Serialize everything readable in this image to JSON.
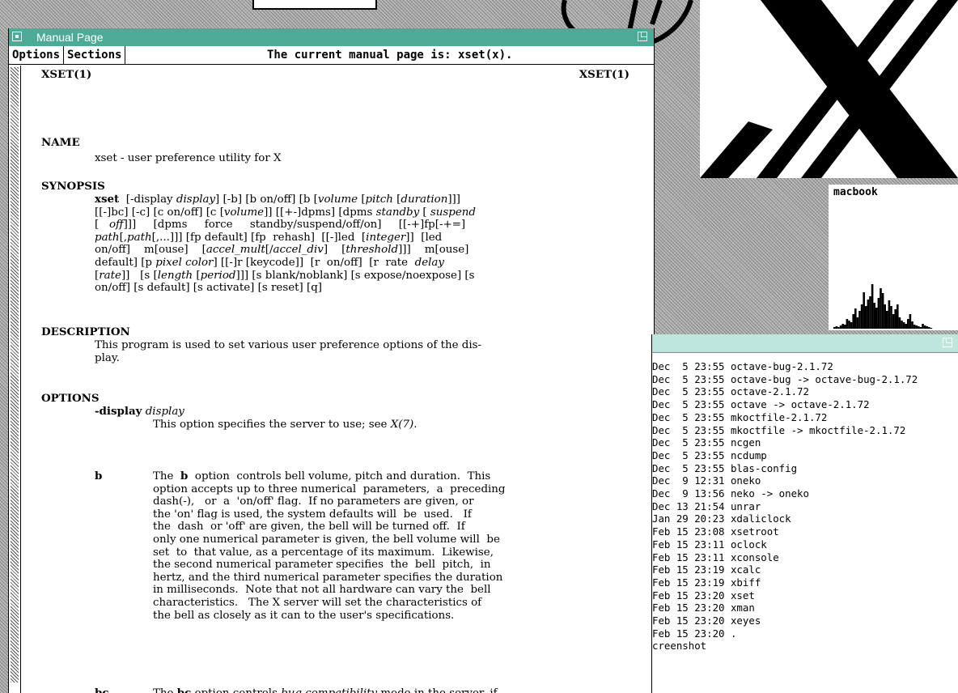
{
  "desktop": {
    "xload_host": "macbook",
    "xload_samples": [
      2,
      3,
      2,
      4,
      6,
      5,
      12,
      10,
      8,
      18,
      25,
      14,
      22,
      30,
      45,
      28,
      36,
      40,
      55,
      32,
      26,
      38,
      50,
      44,
      30,
      22,
      35,
      28,
      18,
      24,
      30,
      14,
      10,
      8,
      6,
      12,
      18,
      9,
      5,
      4,
      3,
      2,
      6,
      4,
      3,
      2,
      1
    ]
  },
  "man": {
    "title": "Manual Page",
    "menu_options": "Options",
    "menu_sections": "Sections",
    "status": "The current manual page is: xset(x).",
    "header_left": "XSET(1)",
    "header_right": "XSET(1)",
    "name_head": "NAME",
    "name_text": "xset - user preference utility for X",
    "synopsis_head": "SYNOPSIS",
    "description_head": "DESCRIPTION",
    "description_text": "This program is used to set various user preference options of the dis-\nplay.",
    "options_head": "OPTIONS",
    "opt_display_text": "This option specifies the server to use; see ",
    "opt_display_ref": "X(7)",
    "opt_b_name": "b",
    "opt_bc_name": "bc"
  },
  "console": {
    "lines": [
      "Dec  5 23:55 octave-bug-2.1.72",
      "Dec  5 23:55 octave-bug -> octave-bug-2.1.72",
      "Dec  5 23:55 octave-2.1.72",
      "Dec  5 23:55 octave -> octave-2.1.72",
      "Dec  5 23:55 mkoctfile-2.1.72",
      "Dec  5 23:55 mkoctfile -> mkoctfile-2.1.72",
      "Dec  5 23:55 ncgen",
      "Dec  5 23:55 ncdump",
      "Dec  5 23:55 blas-config",
      "Dec  9 12:31 oneko",
      "Dec  9 13:56 neko -> oneko",
      "Dec 13 21:54 unrar",
      "Jan 29 20:23 xdaliclock",
      "Feb 15 23:08 xsetroot",
      "Feb 15 23:11 oclock",
      "Feb 15 23:11 xconsole",
      "Feb 15 23:19 xcalc",
      "Feb 15 23:19 xbiff",
      "Feb 15 23:20 xset",
      "Feb 15 23:20 xman",
      "Feb 15 23:20 xeyes",
      "Feb 15 23:20 .",
      "creenshot"
    ]
  }
}
